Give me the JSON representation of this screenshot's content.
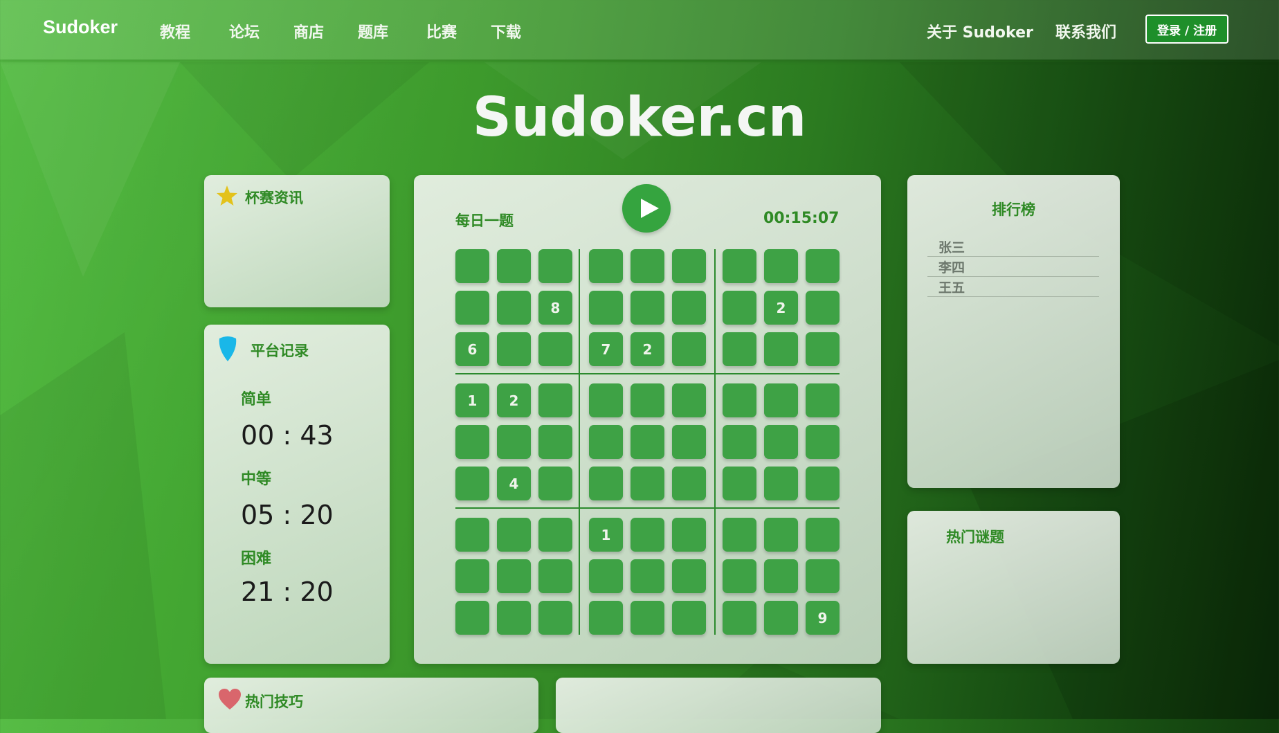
{
  "nav": {
    "brand": "Sudoker",
    "links": [
      "教程",
      "论坛",
      "商店",
      "题库",
      "比赛",
      "下载"
    ],
    "about": "关于 Sudoker",
    "contact": "联系我们",
    "login": "登录 / 注册"
  },
  "site_title": "Sudoker.cn",
  "cup_news": {
    "title": "杯赛资讯",
    "icon": "star-icon",
    "icon_color": "#e3c21a"
  },
  "platform_records": {
    "title": "平台记录",
    "icon": "drop-icon",
    "icon_color": "#19b7e8",
    "records": [
      {
        "label": "简单",
        "time": "00 : 43"
      },
      {
        "label": "中等",
        "time": "05 : 20"
      },
      {
        "label": "困难",
        "time": "21 : 20"
      }
    ]
  },
  "daily": {
    "title": "每日一题",
    "timer": "00:15:07",
    "play_icon": "play-icon",
    "grid": [
      [
        "",
        "",
        "",
        "",
        "",
        "",
        "",
        "",
        ""
      ],
      [
        "",
        "",
        "8",
        "",
        "",
        "",
        "",
        "2",
        ""
      ],
      [
        "6",
        "",
        "",
        "7",
        "2",
        "",
        "",
        "",
        ""
      ],
      [
        "1",
        "2",
        "",
        "",
        "",
        "",
        "",
        "",
        ""
      ],
      [
        "",
        "",
        "",
        "",
        "",
        "",
        "",
        "",
        ""
      ],
      [
        "",
        "4",
        "",
        "",
        "",
        "",
        "",
        "",
        ""
      ],
      [
        "",
        "",
        "",
        "1",
        "",
        "",
        "",
        "",
        ""
      ],
      [
        "",
        "",
        "",
        "",
        "",
        "",
        "",
        "",
        ""
      ],
      [
        "",
        "",
        "",
        "",
        "",
        "",
        "",
        "",
        "9"
      ]
    ]
  },
  "leaderboard": {
    "title": "排行榜",
    "items": [
      "张三",
      "李四",
      "王五"
    ]
  },
  "hot_puzzles": {
    "title": "热门谜题"
  },
  "hot_tips": {
    "title": "热门技巧",
    "icon": "heart-icon",
    "icon_color": "#d9666c"
  },
  "colors": {
    "accent": "#2f8a25",
    "cell": "#3ea245",
    "button": "#1e8f2a"
  }
}
